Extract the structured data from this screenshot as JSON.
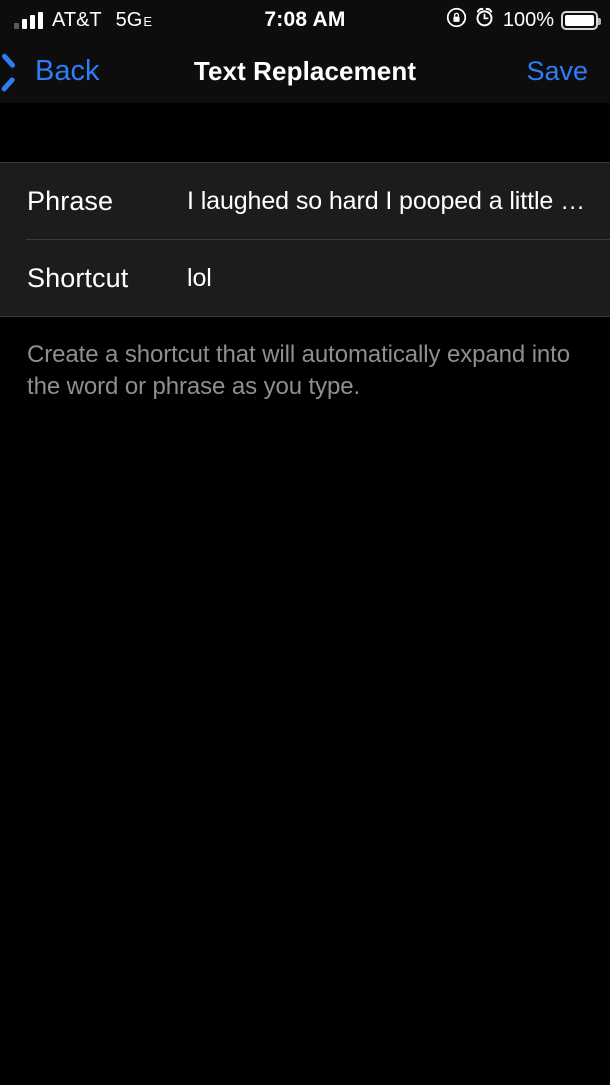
{
  "status_bar": {
    "carrier": "AT&T",
    "network": "5G",
    "network_sub": "E",
    "time": "7:08 AM",
    "battery_percent": "100%",
    "icons": {
      "signal": "signal-bars-icon",
      "rotation_lock": "rotation-lock-icon",
      "alarm": "alarm-clock-icon",
      "battery": "battery-full-icon"
    }
  },
  "nav_bar": {
    "back_label": "Back",
    "title": "Text Replacement",
    "save_label": "Save",
    "accent_color": "#2f7cf6"
  },
  "form": {
    "rows": [
      {
        "label": "Phrase",
        "value": "I laughed so hard I pooped a little bit.",
        "placeholder": "Phrase"
      },
      {
        "label": "Shortcut",
        "value": "lol",
        "placeholder": "Shortcut"
      }
    ],
    "footer_note": "Create a shortcut that will automatically expand into the word or phrase as you type."
  },
  "colors": {
    "background": "#000000",
    "group_background": "#1c1c1e",
    "separator": "#3a3a3c",
    "secondary_text": "#8e8e93"
  }
}
